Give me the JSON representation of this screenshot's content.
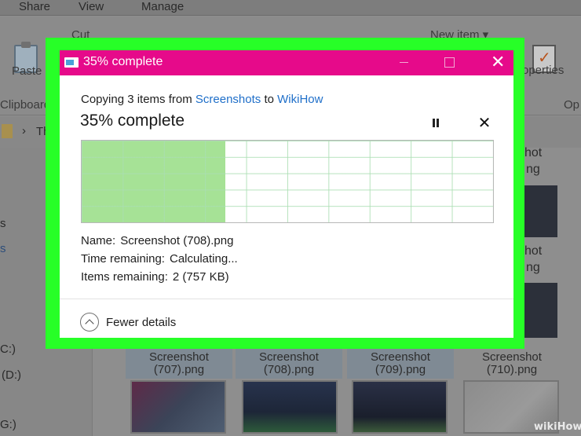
{
  "explorer": {
    "ribbon_tabs": [
      "Share",
      "View",
      "Manage"
    ],
    "ribbon": {
      "cut_label": "Cut",
      "paste_label": "Paste",
      "clipboard_group": "Clipboard",
      "new_item_label": "New item ▾",
      "properties_label": "roperties",
      "open_group": "Op"
    },
    "address_fragment": "Th",
    "nav_items": [
      "s",
      "s",
      "C:)",
      "(D:)",
      "G:)"
    ],
    "tiles": [
      {
        "caption_line1": "Screenshot",
        "caption_line2": "(707).png"
      },
      {
        "caption_line1": "Screenshot",
        "caption_line2": "(708).png"
      },
      {
        "caption_line1": "Screenshot",
        "caption_line2": "(709).png"
      },
      {
        "caption_line1": "Screenshot",
        "caption_line2": "(710).png"
      }
    ],
    "right_fragments": [
      "hot",
      "ng",
      "hot",
      "ng"
    ]
  },
  "dialog": {
    "title": "35% complete",
    "copy_prefix": "Copying 3 items from ",
    "source": "Screenshots",
    "copy_mid": " to ",
    "destination": "WikiHow",
    "heading": "35% complete",
    "progress_fraction": 0.35,
    "name_label": "Name:",
    "name_value": "Screenshot (708).png",
    "time_label": "Time remaining:",
    "time_value": "Calculating...",
    "items_label": "Items remaining:",
    "items_value": "2 (757 KB)",
    "fewer_details": "Fewer details"
  },
  "icons": {
    "title": "copy-dialog-icon",
    "minimize": "minimize-icon",
    "maximize": "maximize-icon",
    "close": "close-icon",
    "pause": "pause-icon",
    "cancel": "cancel-icon",
    "collapse": "chevron-up-icon"
  },
  "colors": {
    "titlebar": "#e60a8a",
    "highlight_frame": "#27ff27",
    "progress_fill": "#a6e296",
    "link": "#1f6fc9"
  },
  "watermark": "wikiHow"
}
